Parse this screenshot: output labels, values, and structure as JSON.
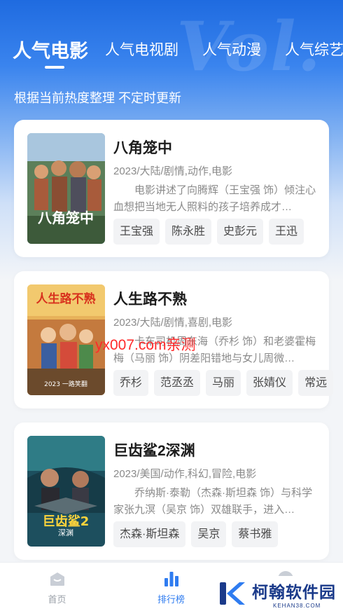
{
  "tabs": [
    {
      "label": "人气电影",
      "active": true
    },
    {
      "label": "人气电视剧",
      "active": false
    },
    {
      "label": "人气动漫",
      "active": false
    },
    {
      "label": "人气综艺",
      "active": false
    }
  ],
  "subtitle": "根据当前热度整理 不定时更新",
  "movies": [
    {
      "title": "八角笼中",
      "meta": "2023/大陆/剧情,动作,电影",
      "desc": "电影讲述了向腾辉（王宝强 饰）倾注心血想把当地无人照料的孩子培养成才…",
      "cast": [
        "王宝强",
        "陈永胜",
        "史彭元",
        "王迅"
      ]
    },
    {
      "title": "人生路不熟",
      "meta": "2023/大陆/剧情,喜剧,电影",
      "desc": "卡车司机周东海（乔杉 饰）和老婆霍梅梅（马丽 饰）阴差阳错地与女儿周微…",
      "cast": [
        "乔杉",
        "范丞丞",
        "马丽",
        "张婧仪",
        "常远"
      ]
    },
    {
      "title": "巨齿鲨2深渊",
      "meta": "2023/美国/动作,科幻,冒险,电影",
      "desc": "乔纳斯·泰勒（杰森·斯坦森 饰）与科学家张九溟（吴京 饰）双雄联手，进入…",
      "cast": [
        "杰森·斯坦森",
        "吴京",
        "蔡书雅"
      ]
    }
  ],
  "watermark": "yx007.com亲测",
  "nav": [
    {
      "label": "首页",
      "active": false
    },
    {
      "label": "排行榜",
      "active": true
    },
    {
      "label": "",
      "active": false
    }
  ],
  "logo": {
    "main": "柯翰软件园",
    "sub": "KEHAN38.COM"
  },
  "colors": {
    "accent": "#2f7cf0",
    "header_top": "#1f6be0"
  }
}
